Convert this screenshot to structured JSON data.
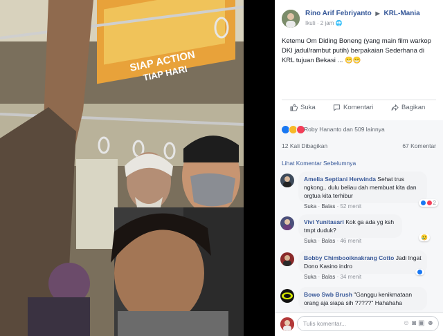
{
  "photo": {
    "banner_line1": "SIAP ACTION",
    "banner_line2": "TIAP HARI"
  },
  "post": {
    "author": "Rino Arif Febriyanto",
    "group": "KRL-Mania",
    "follow_label": "Ikuti",
    "time": "2 jam",
    "text": "Ketemu Om Diding Boneng (yang main film warkop DKI jadul/rambut putih) berpakaian Sederhana di KRL tujuan Bekasi ... 😁😁"
  },
  "actions": {
    "like": "Suka",
    "comment": "Komentari",
    "share": "Bagikan"
  },
  "reactions": {
    "text": "Roby Hananto dan 509 lainnya",
    "icons": [
      "like-icon",
      "wow-icon",
      "love-icon"
    ],
    "colors": {
      "like": "#1877f2",
      "wow": "#f7b928",
      "love": "#f33e58"
    }
  },
  "stats": {
    "shares": "12 Kali Dibagikan",
    "comments": "67 Komentar"
  },
  "comments_section": {
    "previous": "Lihat Komentar Sebelumnya",
    "items": [
      {
        "name": "Amelia Septiani Herwinda",
        "text": "Sehat trus ngkong.. dulu beliau dah membuat kita dan orgtua kita terhibur",
        "like": "Suka",
        "reply": "Balas",
        "time": "52 menit",
        "reaction_count": "2"
      },
      {
        "name": "Vivi Yunitasari",
        "text": "Kok ga ada yg ksh tmpt duduk?",
        "like": "Suka",
        "reply": "Balas",
        "time": "46 menit",
        "reaction_count": ""
      },
      {
        "name": "Bobby Chimbooiknakrang Cotto",
        "text": "Jadi Ingat Dono Kasino indro",
        "like": "Suka",
        "reply": "Balas",
        "time": "34 menit",
        "reaction_count": ""
      },
      {
        "name": "Bowo Swb Brush",
        "text": "\"Ganggu kenikmataan orang aja siapa sih ?????\" Hahahaha",
        "like": "",
        "reply": "",
        "time": "",
        "reaction_count": ""
      }
    ]
  },
  "composer": {
    "placeholder": "Tulis komentar..."
  }
}
